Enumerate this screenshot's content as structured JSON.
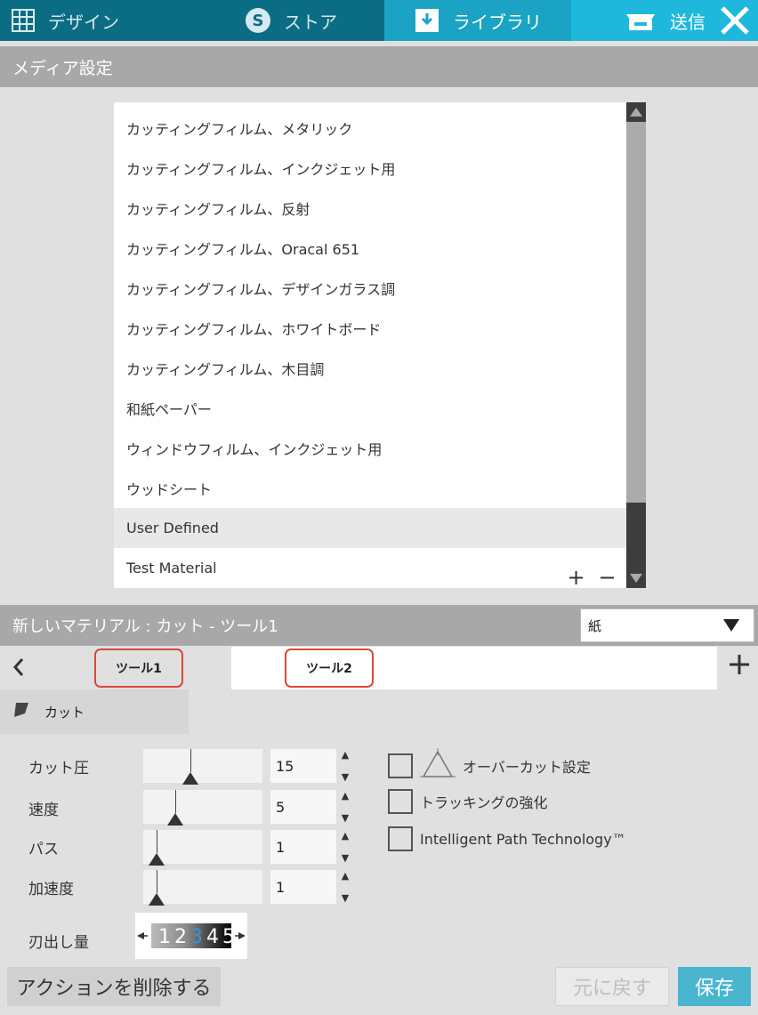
{
  "top_tabs": [
    {
      "label": "デザイン",
      "icon": "grid-icon"
    },
    {
      "label": "ストア",
      "icon": "store-s-icon"
    },
    {
      "label": "ライブラリ",
      "icon": "download-icon"
    },
    {
      "label": "送信",
      "icon": "send-machine-icon"
    }
  ],
  "active_tab": "ライブラリ",
  "header": {
    "title": "メディア設定"
  },
  "materials": [
    "カッティングフィルム、メタリック",
    "カッティングフィルム、インクジェット用",
    "カッティングフィルム、反射",
    "カッティングフィルム、Oracal 651",
    "カッティングフィルム、デザインガラス調",
    "カッティングフィルム、ホワイトボード",
    "カッティングフィルム、木目調",
    "和紙ペーパー",
    "ウィンドウフィルム、インクジェット用",
    "ウッドシート",
    "User Defined",
    "Test Material"
  ],
  "selected_material": "User Defined",
  "list_buttons": {
    "add": "+",
    "remove": "−"
  },
  "material_bar": {
    "title": "新しいマテリアル : カット - ツール1",
    "type_select": "紙"
  },
  "tools": {
    "tool1": "ツール1",
    "tool2": "ツール2"
  },
  "cut_tab": {
    "label": "カット"
  },
  "settings": {
    "force": {
      "label": "カット圧",
      "value": "15",
      "slider_fraction": 0.33
    },
    "speed": {
      "label": "速度",
      "value": "5",
      "slider_fraction": 0.18
    },
    "passes": {
      "label": "パス",
      "value": "1",
      "slider_fraction": 0.0
    },
    "acceleration": {
      "label": "加速度",
      "value": "1",
      "slider_fraction": 0.0
    }
  },
  "options": {
    "overcut": "オーバーカット設定",
    "tracking": "トラッキングの強化",
    "ipt": "Intelligent Path Technology™"
  },
  "blade": {
    "label": "刃出し量",
    "digits": [
      "1",
      "2",
      "3",
      "4",
      "5"
    ],
    "selected_digit": "3"
  },
  "footer": {
    "delete": "アクションを削除する",
    "revert": "元に戻す",
    "save": "保存"
  },
  "colors": {
    "accent": "#1aa3c4",
    "header_gray": "#a8a8a8",
    "highlight_red": "#d9483b"
  }
}
